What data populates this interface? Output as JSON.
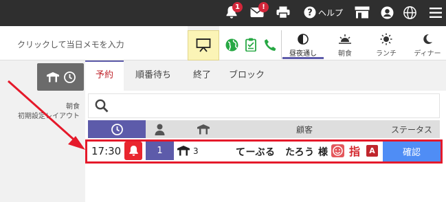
{
  "topbar": {
    "notification_badge": "1",
    "message_badge": "!",
    "help_label": "ヘルプ"
  },
  "toolbar": {
    "memo_placeholder": "クリックして当日メモを入力",
    "meal_tabs": [
      {
        "label": "昼夜通し",
        "icon": "half-circle-icon",
        "active": true
      },
      {
        "label": "朝食",
        "icon": "sunrise-icon",
        "active": false
      },
      {
        "label": "ランチ",
        "icon": "sun-icon",
        "active": false
      },
      {
        "label": "ディナー",
        "icon": "moon-icon",
        "active": false
      }
    ]
  },
  "left_panel": {
    "meal_label": "朝食",
    "layout_label": "初期設定レイアウト"
  },
  "tabs": [
    "予約",
    "順番待ち",
    "終了",
    "ブロック"
  ],
  "table_header": {
    "customer": "顧客",
    "status": "ステータス"
  },
  "reservation": {
    "time": "17:30",
    "party_size": "1",
    "table": "3",
    "customer_name": "てーぶる　たろう 様",
    "designation": "指",
    "badge_letter": "A",
    "status_button": "確認"
  },
  "colors": {
    "topbar": "#2f2f2f",
    "accent_purple": "#5d5baa",
    "alert_red": "#e9262f",
    "confirm_blue": "#4f8df5",
    "highlight_red": "#e5192a",
    "green_icons": "#27a844"
  }
}
